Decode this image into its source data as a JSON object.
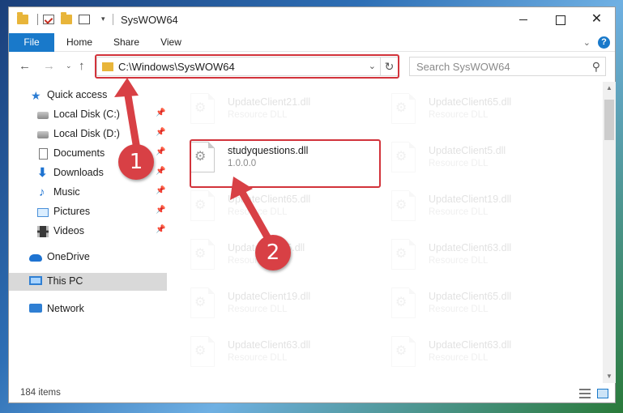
{
  "window": {
    "title": "SysWOW64",
    "close_glyph": "✕"
  },
  "ribbon": {
    "tabs": [
      "File",
      "Home",
      "Share",
      "View"
    ],
    "collapse_glyph": "⌄",
    "help_glyph": "?"
  },
  "nav": {
    "back_glyph": "←",
    "forward_glyph": "→",
    "recent_glyph": "⌄",
    "up_glyph": "↑",
    "address": "C:\\Windows\\SysWOW64",
    "address_drop": "⌄",
    "refresh_glyph": "↻",
    "search_placeholder": "Search SysWOW64",
    "search_glyph": "⚲"
  },
  "sidebar": {
    "items": [
      {
        "label": "Quick access",
        "icon": "star-icon",
        "glyph": "★"
      },
      {
        "label": "Local Disk (C:)",
        "icon": "local-disk-icon",
        "pinned": true
      },
      {
        "label": "Local Disk (D:)",
        "icon": "local-disk-icon",
        "pinned": true
      },
      {
        "label": "Documents",
        "icon": "documents-icon",
        "pinned": true
      },
      {
        "label": "Downloads",
        "icon": "downloads-icon",
        "glyph": "⬇",
        "pinned": true
      },
      {
        "label": "Music",
        "icon": "music-icon",
        "glyph": "♪",
        "pinned": true
      },
      {
        "label": "Pictures",
        "icon": "pictures-icon",
        "pinned": true
      },
      {
        "label": "Videos",
        "icon": "videos-icon",
        "pinned": true
      },
      {
        "label": "OneDrive",
        "icon": "onedrive-icon"
      },
      {
        "label": "This PC",
        "icon": "this-pc-icon",
        "selected": true
      },
      {
        "label": "Network",
        "icon": "network-icon"
      }
    ],
    "pin_glyph": "📌"
  },
  "files": [
    {
      "name": "UpdateClient21.dll",
      "desc": "Resource DLL",
      "faded": true
    },
    {
      "name": "UpdateClient65.dll",
      "desc": "Resource DLL",
      "faded": true
    },
    {
      "name": "studyquestions.dll",
      "desc": "1.0.0.0",
      "faded": false
    },
    {
      "name": "UpdateClient5.dll",
      "desc": "Resource DLL",
      "faded": true
    },
    {
      "name": "UpdateClient65.dll",
      "desc": "Resource DLL",
      "faded": true
    },
    {
      "name": "UpdateClient19.dll",
      "desc": "Resource DLL",
      "faded": true
    },
    {
      "name": "UpdateClient5.dll",
      "desc": "Resource DLL",
      "faded": true
    },
    {
      "name": "UpdateClient63.dll",
      "desc": "Resource DLL",
      "faded": true
    },
    {
      "name": "UpdateClient19.dll",
      "desc": "Resource DLL",
      "faded": true
    },
    {
      "name": "UpdateClient65.dll",
      "desc": "Resource DLL",
      "faded": true
    },
    {
      "name": "UpdateClient63.dll",
      "desc": "Resource DLL",
      "faded": true
    },
    {
      "name": "UpdateClient63.dll",
      "desc": "Resource DLL",
      "faded": true
    }
  ],
  "file_icon_glyph": "⚙",
  "status": {
    "item_count": "184 items"
  },
  "scroll": {
    "up_glyph": "▲",
    "down_glyph": "▼"
  },
  "callouts": [
    "1",
    "2"
  ],
  "colors": {
    "accent": "#1979ca",
    "highlight": "#d2333b",
    "callout": "#d84045"
  }
}
